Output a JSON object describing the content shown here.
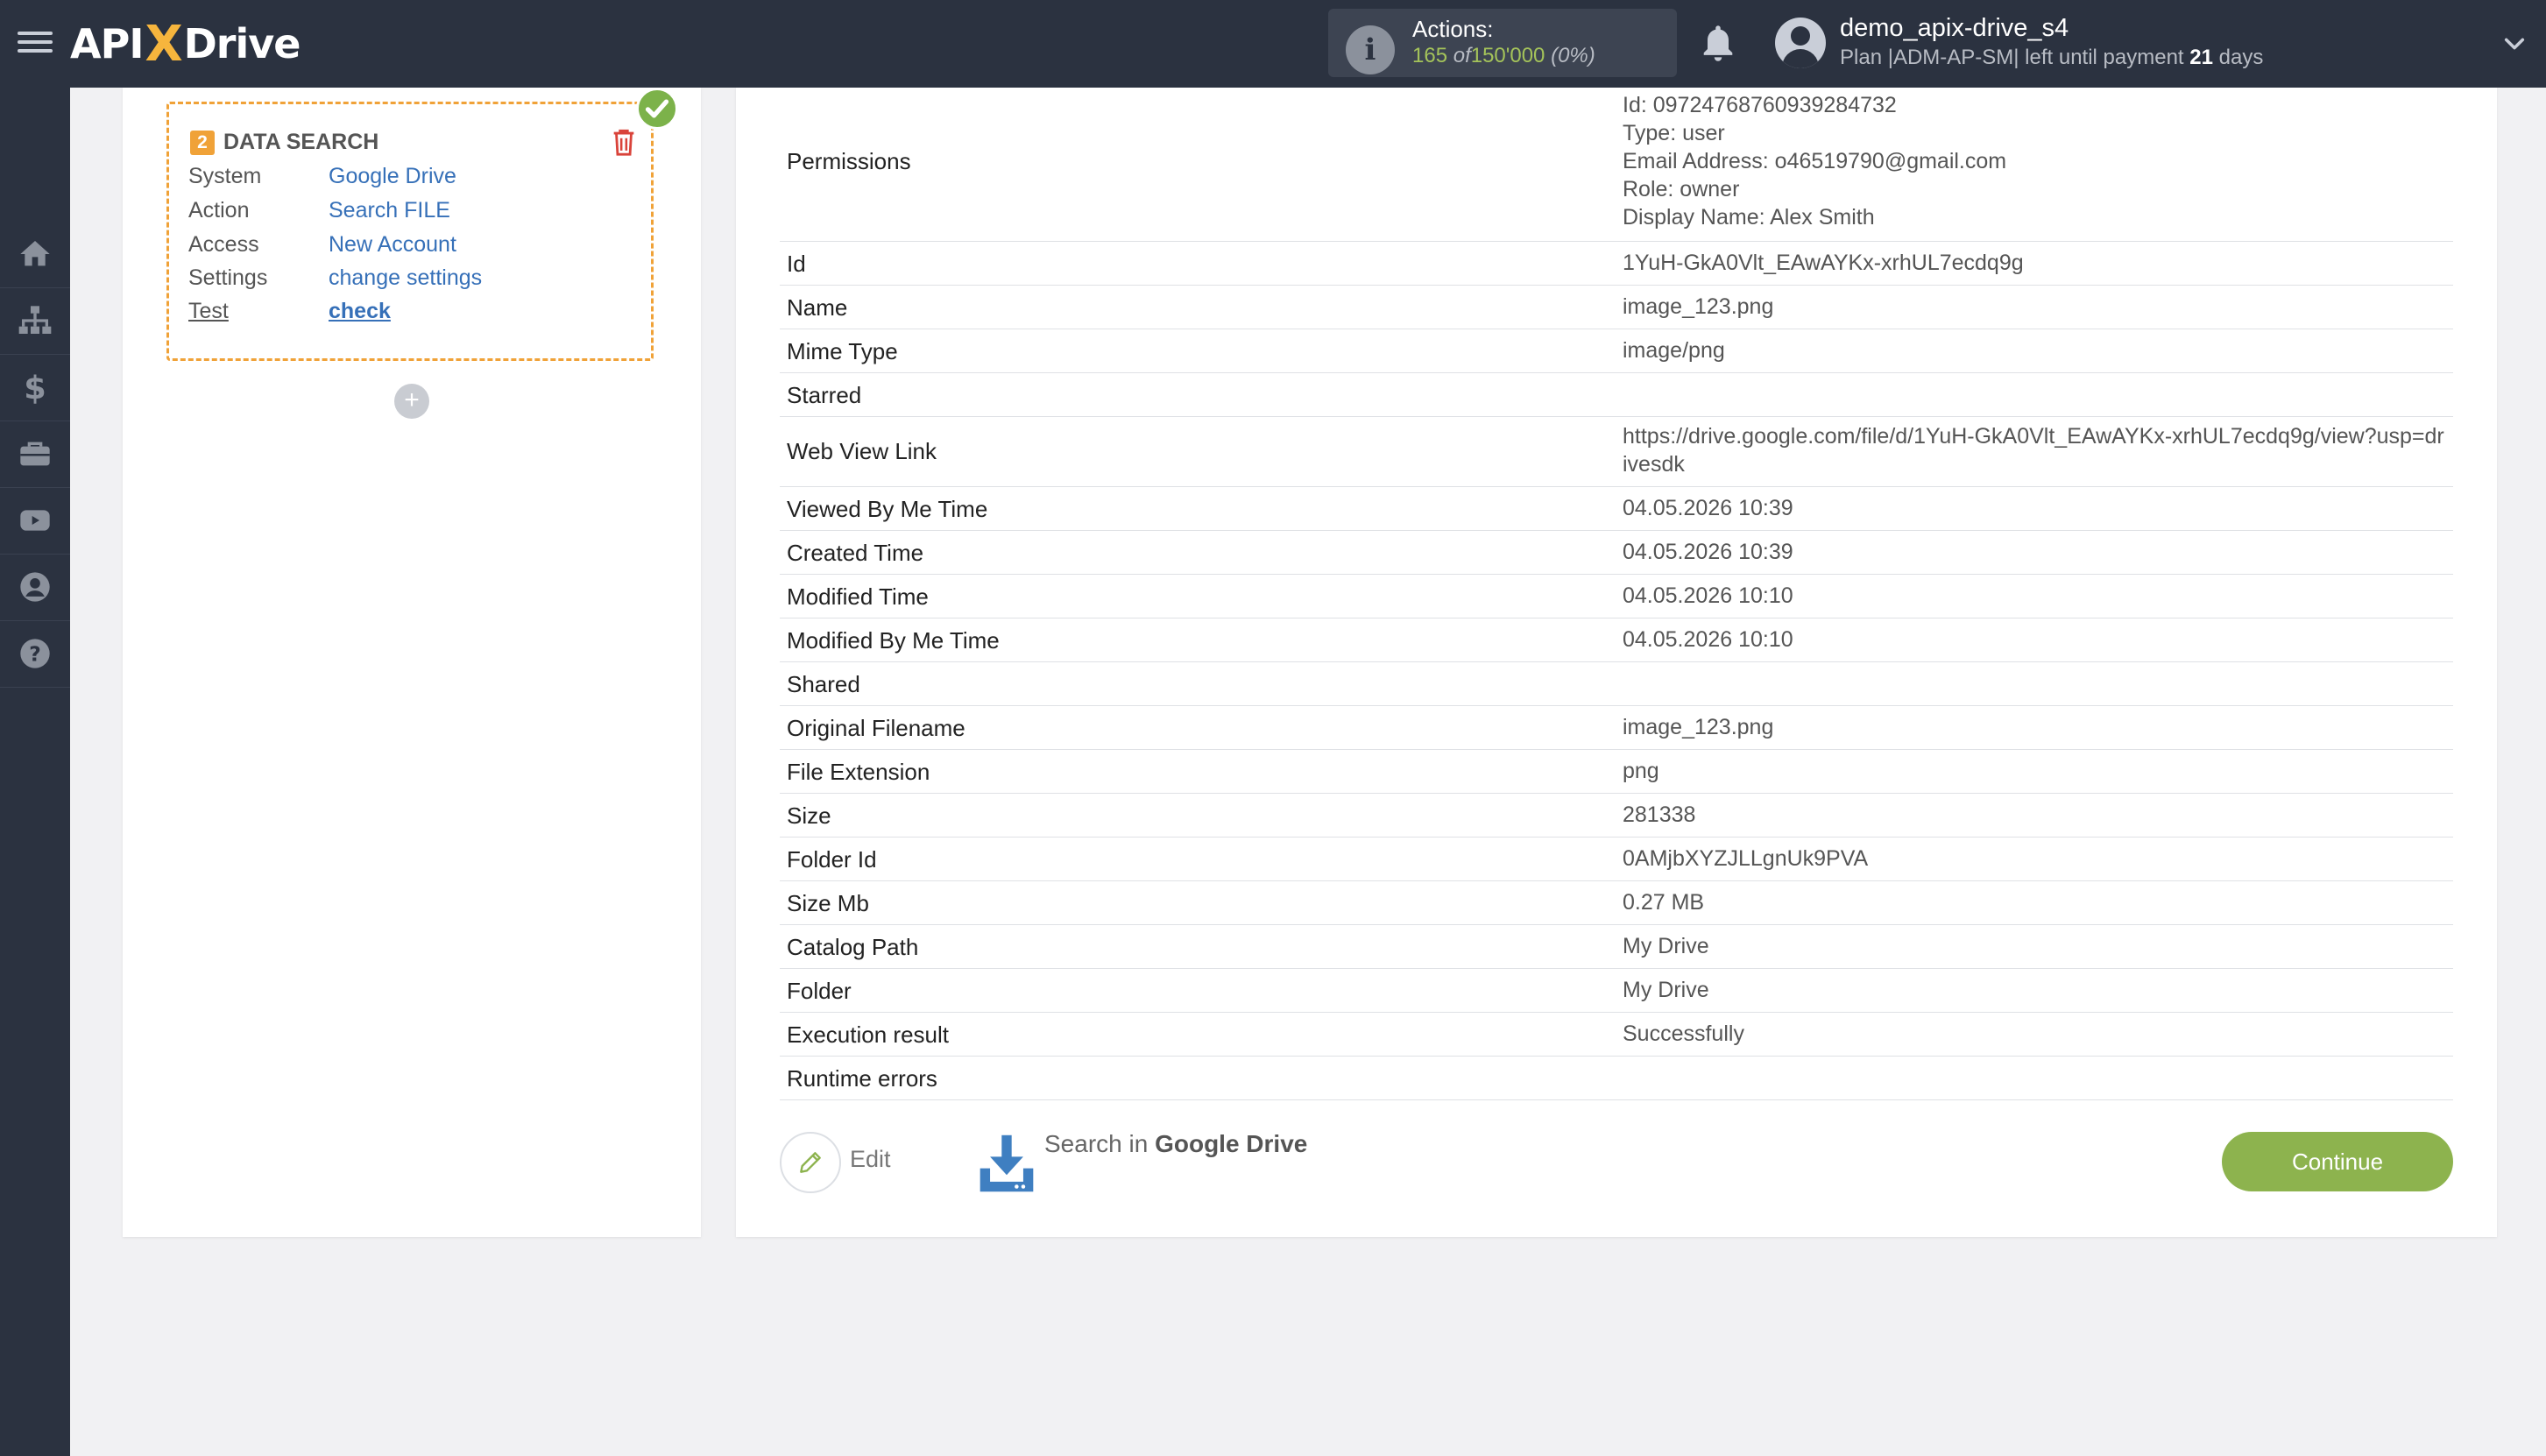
{
  "header": {
    "logo_left": "API",
    "logo_x": "X",
    "logo_right": "Drive",
    "actions_label": "Actions:",
    "actions_used": "165",
    "actions_of": "of",
    "actions_total": "150'000",
    "actions_pct": "(0%)",
    "user_name": "demo_apix-drive_s4",
    "plan_prefix": "Plan |ADM-AP-SM| left until payment",
    "plan_days": "21",
    "plan_suffix": "days"
  },
  "data_search": {
    "step": "2",
    "title": "DATA SEARCH",
    "rows": [
      {
        "label": "System",
        "value": "Google Drive"
      },
      {
        "label": "Action",
        "value": "Search FILE"
      },
      {
        "label": "Access",
        "value": "New Account"
      },
      {
        "label": "Settings",
        "value": "change settings"
      },
      {
        "label": "Test",
        "value": "check"
      }
    ],
    "add_symbol": "+"
  },
  "result": {
    "permissions_label": "Permissions",
    "permissions_lines": [
      "Id: 09724768760939284732",
      "Type: user",
      "Email Address: o46519790@gmail.com",
      "Role: owner",
      "Display Name: Alex Smith"
    ],
    "rows": [
      {
        "label": "Id",
        "value": "1YuH-GkA0Vlt_EAwAYKx-xrhUL7ecdq9g"
      },
      {
        "label": "Name",
        "value": "image_123.png"
      },
      {
        "label": "Mime Type",
        "value": "image/png"
      },
      {
        "label": "Starred",
        "value": ""
      },
      {
        "label": "Web View Link",
        "value": "https://drive.google.com/file/d/1YuH-GkA0Vlt_EAwAYKx-xrhUL7ecdq9g/view?usp=drivesdk"
      },
      {
        "label": "Viewed By Me Time",
        "value": "04.05.2026 10:39"
      },
      {
        "label": "Created Time",
        "value": "04.05.2026 10:39"
      },
      {
        "label": "Modified Time",
        "value": "04.05.2026 10:10"
      },
      {
        "label": "Modified By Me Time",
        "value": "04.05.2026 10:10"
      },
      {
        "label": "Shared",
        "value": ""
      },
      {
        "label": "Original Filename",
        "value": "image_123.png"
      },
      {
        "label": "File Extension",
        "value": "png"
      },
      {
        "label": "Size",
        "value": "281338"
      },
      {
        "label": "Folder Id",
        "value": "0AMjbXYZJLLgnUk9PVA"
      },
      {
        "label": "Size Mb",
        "value": "0.27 MB"
      },
      {
        "label": "Catalog Path",
        "value": "My Drive"
      },
      {
        "label": "Folder",
        "value": "My Drive"
      },
      {
        "label": "Execution result",
        "value": "Successfully"
      },
      {
        "label": "Runtime errors",
        "value": ""
      }
    ]
  },
  "footer": {
    "edit_label": "Edit",
    "search_prefix": "Search in",
    "search_service": "Google Drive",
    "continue_label": "Continue"
  },
  "icons": {
    "menu": "hamburger-icon",
    "info": "info-icon",
    "bell": "bell-icon",
    "user": "user-avatar-icon",
    "chevron": "chevron-down-icon",
    "sidebar": [
      "home-icon",
      "sitemap-icon",
      "dollar-icon",
      "briefcase-icon",
      "youtube-icon",
      "user-circle-icon",
      "help-icon"
    ],
    "trash": "trash-icon",
    "check": "check-icon",
    "pencil": "pencil-icon",
    "download": "download-icon"
  },
  "colors": {
    "topbar": "#2b3240",
    "accent_orange": "#f0a238",
    "link_blue": "#3670b8",
    "success_green": "#7cb24a",
    "continue_green": "#8db34e"
  }
}
